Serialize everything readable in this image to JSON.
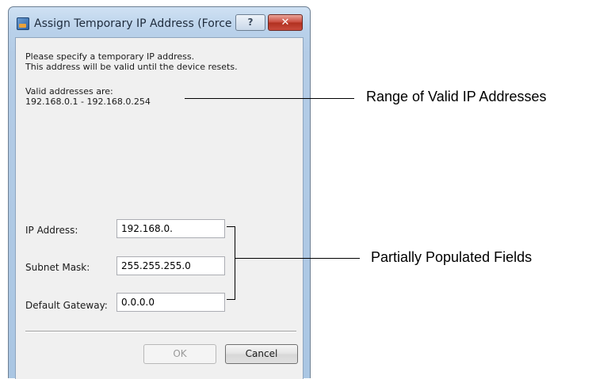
{
  "window": {
    "title": "Assign Temporary IP Address (Force ...",
    "help_glyph": "?",
    "close_glyph": "✕",
    "icon": "network-device-icon"
  },
  "intro": {
    "line1": "Please specify a temporary IP address.",
    "line2": "This address will be valid until the device resets."
  },
  "range": {
    "heading": "Valid addresses are:",
    "value": "192.168.0.1 - 192.168.0.254"
  },
  "form": {
    "ip_label": "IP Address:",
    "ip_value": "192.168.0.",
    "subnet_label": "Subnet Mask:",
    "subnet_value": "255.255.255.0",
    "gateway_label": "Default Gateway:",
    "gateway_value": "0.0.0.0"
  },
  "buttons": {
    "ok": "OK",
    "cancel": "Cancel"
  },
  "callouts": {
    "range": "Range of Valid IP Addresses",
    "fields": "Partially Populated Fields"
  }
}
